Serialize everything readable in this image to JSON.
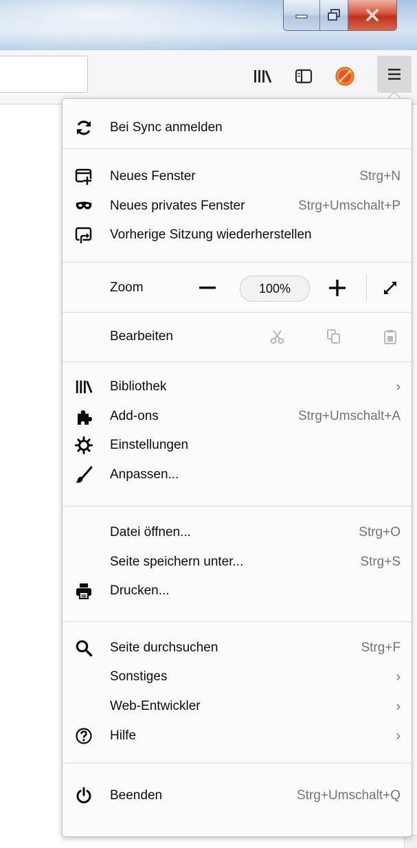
{
  "window": {
    "controls": [
      "minimize-icon",
      "maximize-icon",
      "close-icon"
    ]
  },
  "toolbar": {
    "icons": [
      "library-icon",
      "sidebar-icon",
      "addon-badge-icon",
      "hamburger-menu-icon"
    ]
  },
  "menu": {
    "sync": {
      "label": "Bei Sync anmelden",
      "icon": "sync-icon"
    },
    "new_window": {
      "label": "Neues Fenster",
      "shortcut": "Strg+N",
      "icon": "new-window-icon"
    },
    "private_window": {
      "label": "Neues privates Fenster",
      "shortcut": "Strg+Umschalt+P",
      "icon": "private-mask-icon"
    },
    "restore_session": {
      "label": "Vorherige Sitzung wiederherstellen",
      "icon": "restore-session-icon"
    },
    "zoom": {
      "label": "Zoom",
      "minus": "−",
      "value": "100%",
      "plus": "+"
    },
    "edit": {
      "label": "Bearbeiten"
    },
    "library": {
      "label": "Bibliothek",
      "icon": "library-icon"
    },
    "addons": {
      "label": "Add-ons",
      "shortcut": "Strg+Umschalt+A",
      "icon": "puzzle-icon"
    },
    "settings": {
      "label": "Einstellungen",
      "icon": "gear-icon"
    },
    "customize": {
      "label": "Anpassen...",
      "icon": "brush-icon"
    },
    "open_file": {
      "label": "Datei öffnen...",
      "shortcut": "Strg+O"
    },
    "save_page": {
      "label": "Seite speichern unter...",
      "shortcut": "Strg+S"
    },
    "print": {
      "label": "Drucken...",
      "icon": "printer-icon"
    },
    "find": {
      "label": "Seite durchsuchen",
      "shortcut": "Strg+F",
      "icon": "search-icon"
    },
    "more": {
      "label": "Sonstiges"
    },
    "web_dev": {
      "label": "Web-Entwickler"
    },
    "help": {
      "label": "Hilfe",
      "icon": "help-icon"
    },
    "quit": {
      "label": "Beenden",
      "shortcut": "Strg+Umschalt+Q",
      "icon": "power-icon"
    }
  }
}
